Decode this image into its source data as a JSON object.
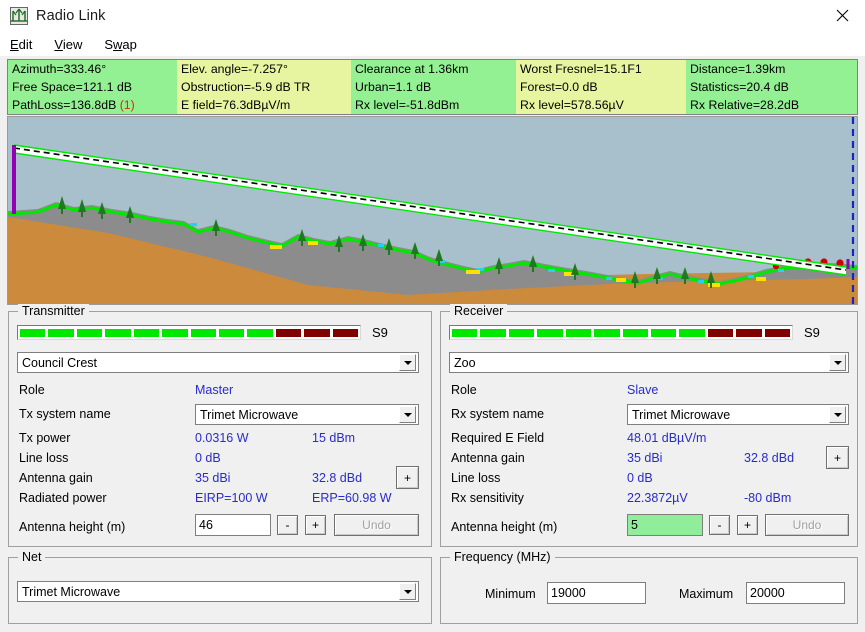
{
  "window": {
    "title": "Radio Link",
    "app_icon": "antenna-icon",
    "close_label": "✕"
  },
  "menu": [
    {
      "label": "Edit",
      "accel": "E"
    },
    {
      "label": "View",
      "accel": "V"
    },
    {
      "label": "Swap",
      "accel": "w"
    }
  ],
  "info": {
    "rows": [
      [
        {
          "text": "Azimuth=333.46°"
        },
        {
          "text": "Elev. angle=-7.257°"
        },
        {
          "text": "Clearance at 1.36km"
        },
        {
          "text": "Worst Fresnel=15.1F1"
        },
        {
          "text": "Distance=1.39km"
        }
      ],
      [
        {
          "text": "Free Space=121.1 dB"
        },
        {
          "text": "Obstruction=-5.9 dB TR"
        },
        {
          "text": "Urban=1.1 dB"
        },
        {
          "text": "Forest=0.0 dB"
        },
        {
          "text": "Statistics=20.4 dB"
        }
      ],
      [
        {
          "text": "PathLoss=136.8dB ",
          "warn": "(1)"
        },
        {
          "text": "E field=76.3dBµV/m"
        },
        {
          "text": "Rx level=-51.8dBm"
        },
        {
          "text": "Rx level=578.56µV"
        },
        {
          "text": "Rx Relative=28.2dB"
        }
      ]
    ]
  },
  "profile": {
    "sky_color": "#a8c0cc",
    "ground_color": "#cc8a3c",
    "terrain_color": "#8c8c8c",
    "los_color": "#00e000",
    "tree_color": "#1f7a1f",
    "mast_color": "#9400b4",
    "marker_color": "#d00000",
    "water_color": "#28d0f0",
    "cursor_color": "#2020c8"
  },
  "transmitter": {
    "group_title": "Transmitter",
    "meter": {
      "segments": [
        "g",
        "g",
        "g",
        "g",
        "g",
        "g",
        "g",
        "g",
        "g",
        "r",
        "r",
        "r"
      ],
      "label": "S9"
    },
    "site": "Council Crest",
    "fields": [
      {
        "label": "Role",
        "value": "Master"
      },
      {
        "label": "Tx system name",
        "value": "Trimet Microwave"
      },
      {
        "label": "Tx power",
        "value": "0.0316 W",
        "value2": "15 dBm"
      },
      {
        "label": "Line loss",
        "value": "0 dB"
      },
      {
        "label": "Antenna gain",
        "value": "35 dBi",
        "value2": "32.8 dBd"
      },
      {
        "label": "Radiated power",
        "value": "EIRP=100 W",
        "value2": "ERP=60.98 W"
      }
    ],
    "gain_plus": "+",
    "height_label": "Antenna height (m)",
    "height_value": "46",
    "minus": "-",
    "plus": "+",
    "undo": "Undo"
  },
  "receiver": {
    "group_title": "Receiver",
    "meter": {
      "segments": [
        "g",
        "g",
        "g",
        "g",
        "g",
        "g",
        "g",
        "g",
        "g",
        "r",
        "r",
        "r"
      ],
      "label": "S9"
    },
    "site": "Zoo",
    "fields": [
      {
        "label": "Role",
        "value": "Slave"
      },
      {
        "label": "Rx system name",
        "value": "Trimet Microwave"
      },
      {
        "label": "Required E Field",
        "value": "48.01 dBµV/m"
      },
      {
        "label": "Antenna gain",
        "value": "35 dBi",
        "value2": "32.8 dBd"
      },
      {
        "label": "Line loss",
        "value": "0 dB"
      },
      {
        "label": "Rx sensitivity",
        "value": "22.3872µV",
        "value2": "-80 dBm"
      }
    ],
    "gain_plus": "+",
    "height_label": "Antenna height (m)",
    "height_value": "5",
    "minus": "-",
    "plus": "+",
    "undo": "Undo"
  },
  "net": {
    "group_title": "Net",
    "value": "Trimet Microwave"
  },
  "frequency": {
    "group_title": "Frequency (MHz)",
    "min_label": "Minimum",
    "min_value": "19000",
    "max_label": "Maximum",
    "max_value": "20000"
  }
}
